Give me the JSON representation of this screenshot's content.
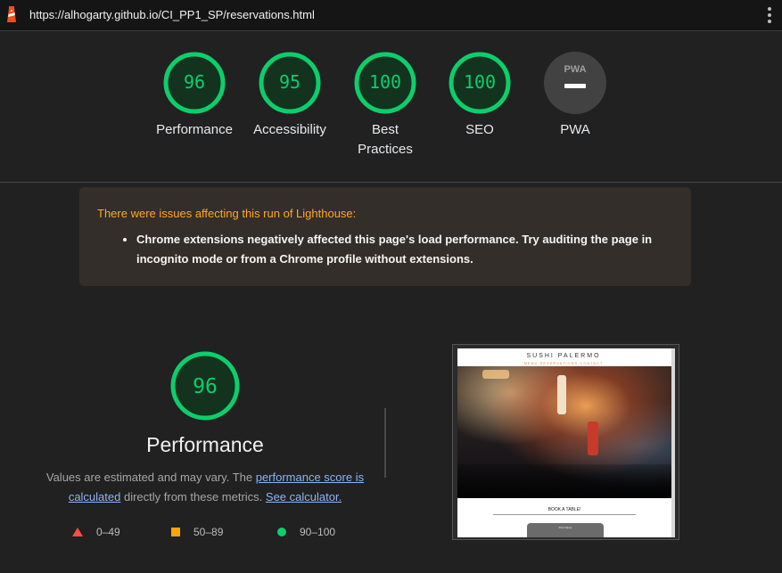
{
  "browser": {
    "url": "https://alhogarty.github.io/CI_PP1_SP/reservations.html"
  },
  "scores": [
    {
      "label": "Performance",
      "value": "96",
      "percent": 96
    },
    {
      "label": "Accessibility",
      "value": "95",
      "percent": 95
    },
    {
      "label": "Best Practices",
      "value": "100",
      "percent": 100
    },
    {
      "label": "SEO",
      "value": "100",
      "percent": 100
    },
    {
      "label": "PWA",
      "value": "",
      "badge": "PWA"
    }
  ],
  "warning": {
    "title": "There were issues affecting this run of Lighthouse:",
    "items": [
      "Chrome extensions negatively affected this page's load performance. Try auditing the page in incognito mode or from a Chrome profile without extensions."
    ]
  },
  "performance": {
    "score": "96",
    "percent": 96,
    "title": "Performance",
    "desc_before": "Values are estimated and may vary. The ",
    "desc_link1": "performance score is calculated",
    "desc_middle": " directly from these metrics. ",
    "desc_link2": "See calculator."
  },
  "legend": {
    "fail": "0–49",
    "average": "50–89",
    "pass": "90–100"
  },
  "thumbnail": {
    "brand": "SUSHI PALERMO",
    "nav": "MENU  RESERVATIONS  CONTACT",
    "book": "BOOK A TABLE!",
    "form_label": "First Name"
  },
  "colors": {
    "pass": "#0cce6b",
    "average": "#ffa400",
    "fail": "#ff4e42",
    "warning_title": "#ffa726",
    "link": "#8ab4f8"
  }
}
